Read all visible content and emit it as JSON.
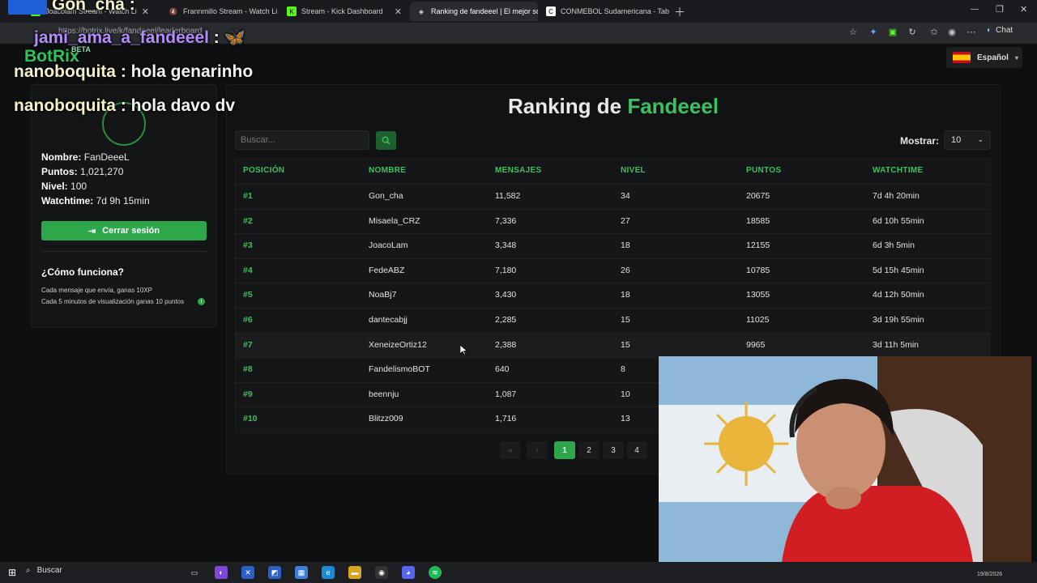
{
  "browser": {
    "tabs": [
      {
        "title": "Joacolam Stream - Watch Li",
        "active": false
      },
      {
        "title": "Frannmillo Stream - Watch Li",
        "active": false
      },
      {
        "title": "Stream - Kick Dashboard",
        "active": false
      },
      {
        "title": "Ranking de fandeeel | El mejor so",
        "active": true
      },
      {
        "title": "CONMEBOL Sudamericana - Tabl",
        "active": false
      }
    ],
    "url": "https://botrix.live/k/fandeeel/leaderboard",
    "chat_label": "Chat"
  },
  "overlay": {
    "top_user": "Gon_cha",
    "messages": [
      {
        "user": "jami_ama_a_fandeeel",
        "text": ""
      },
      {
        "user": "nanoboquita",
        "text": "hola genarinho"
      },
      {
        "user": "nanoboquita",
        "text": "hola davo dv"
      }
    ],
    "brand": "BotRix",
    "brand_badge": "BETA"
  },
  "language": "Español",
  "profile": {
    "name_label": "Nombre:",
    "name": "FanDeeeL",
    "points_label": "Puntos:",
    "points": "1,021,270",
    "level_label": "Nivel:",
    "level": "100",
    "watch_label": "Watchtime:",
    "watchtime": "7d 9h 15min",
    "logout_label": "Cerrar sesión"
  },
  "how": {
    "title": "¿Cómo funciona?",
    "line1": "Cada mensaje que envía, ganas 10XP",
    "line2": "Cada 5 minutos de visualización ganas 10 puntos"
  },
  "ranking": {
    "title_prefix": "Ranking de",
    "title_name": "Fandeeel",
    "search_placeholder": "Buscar...",
    "show_label": "Mostrar:",
    "show_value": "10",
    "columns": [
      "POSICIÓN",
      "NOMBRE",
      "MENSAJES",
      "NIVEL",
      "PUNTOS",
      "WATCHTIME"
    ],
    "rows": [
      {
        "pos": "#1",
        "name": "Gon_cha",
        "msgs": "11,582",
        "level": "34",
        "points": "20675",
        "watch": "7d 4h 20min"
      },
      {
        "pos": "#2",
        "name": "Misaela_CRZ",
        "msgs": "7,336",
        "level": "27",
        "points": "18585",
        "watch": "6d 10h 55min"
      },
      {
        "pos": "#3",
        "name": "JoacoLam",
        "msgs": "3,348",
        "level": "18",
        "points": "12155",
        "watch": "6d 3h 5min"
      },
      {
        "pos": "#4",
        "name": "FedeABZ",
        "msgs": "7,180",
        "level": "26",
        "points": "10785",
        "watch": "5d 15h 45min"
      },
      {
        "pos": "#5",
        "name": "NoaBj7",
        "msgs": "3,430",
        "level": "18",
        "points": "13055",
        "watch": "4d 12h 50min"
      },
      {
        "pos": "#6",
        "name": "dantecabjj",
        "msgs": "2,285",
        "level": "15",
        "points": "11025",
        "watch": "3d 19h 55min"
      },
      {
        "pos": "#7",
        "name": "XeneizeOrtiz12",
        "msgs": "2,388",
        "level": "15",
        "points": "9965",
        "watch": "3d 11h 5min"
      },
      {
        "pos": "#8",
        "name": "FandelismoBOT",
        "msgs": "640",
        "level": "8",
        "points": "",
        "watch": ""
      },
      {
        "pos": "#9",
        "name": "beennju",
        "msgs": "1,087",
        "level": "10",
        "points": "",
        "watch": ""
      },
      {
        "pos": "#10",
        "name": "Blitzz009",
        "msgs": "1,716",
        "level": "13",
        "points": "",
        "watch": ""
      }
    ],
    "pages": [
      "1",
      "2",
      "3",
      "4"
    ],
    "first_label": "«",
    "prev_label": "‹"
  },
  "taskbar": {
    "search_label": "Buscar",
    "date": "19/8/2026"
  },
  "colors": {
    "accent": "#2ea64a",
    "accent_text": "#3fbf5f",
    "bg": "#0e0f10"
  }
}
